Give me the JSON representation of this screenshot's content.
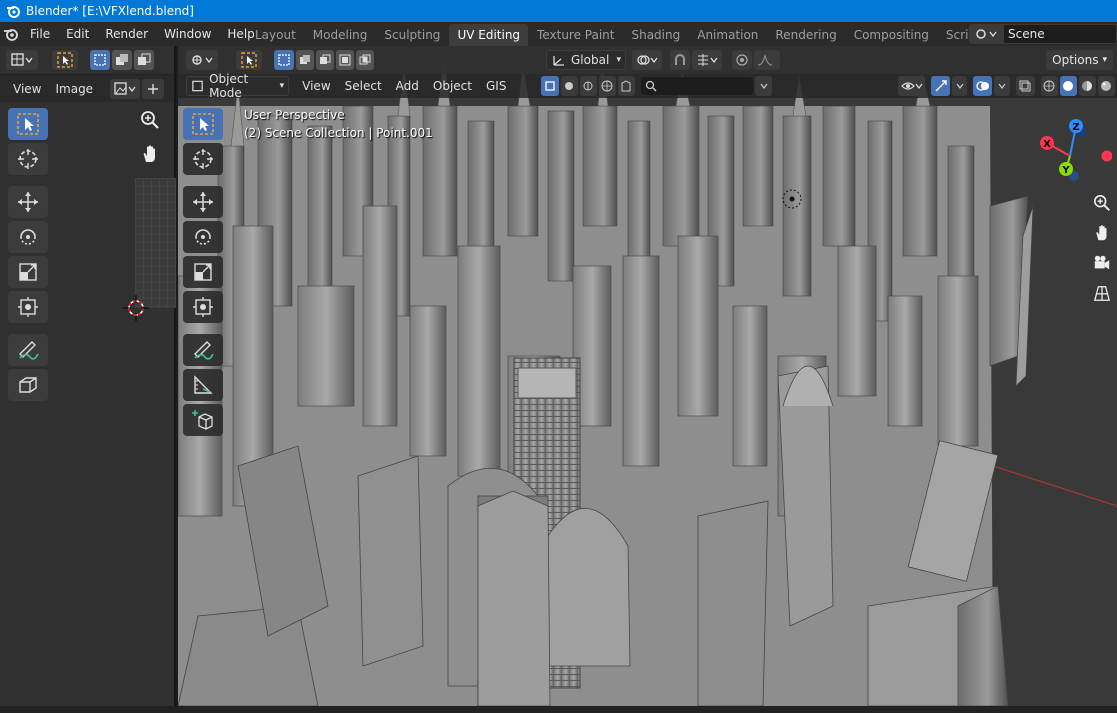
{
  "window": {
    "title": "Blender* [E:\\VFXlend.blend]"
  },
  "menu": {
    "items": [
      "File",
      "Edit",
      "Render",
      "Window",
      "Help"
    ]
  },
  "workspace_tabs": [
    {
      "label": "Layout",
      "active": false
    },
    {
      "label": "Modeling",
      "active": false
    },
    {
      "label": "Sculpting",
      "active": false
    },
    {
      "label": "UV Editing",
      "active": true
    },
    {
      "label": "Texture Paint",
      "active": false
    },
    {
      "label": "Shading",
      "active": false
    },
    {
      "label": "Animation",
      "active": false
    },
    {
      "label": "Rendering",
      "active": false
    },
    {
      "label": "Compositing",
      "active": false
    },
    {
      "label": "Scripting",
      "active": false
    }
  ],
  "scene": {
    "name": "Scene"
  },
  "uv_editor": {
    "menu": {
      "view": "View",
      "image": "Image"
    }
  },
  "viewport": {
    "mode": "Object Mode",
    "menu": {
      "view": "View",
      "select": "Select",
      "add": "Add",
      "object": "Object",
      "gis": "GIS"
    },
    "transform_orientation": "Global",
    "options_label": "Options",
    "overlay": {
      "perspective": "User Perspective",
      "collection": "(2) Scene Collection | Point.001"
    },
    "gizmo": {
      "x": "X",
      "y": "Y",
      "z": "Z"
    }
  },
  "colors": {
    "accent": "#4772b3",
    "titlebar": "#0078d7",
    "x_axis": "#ff3352",
    "y_axis": "#8bdc00",
    "z_axis": "#2890ff"
  }
}
